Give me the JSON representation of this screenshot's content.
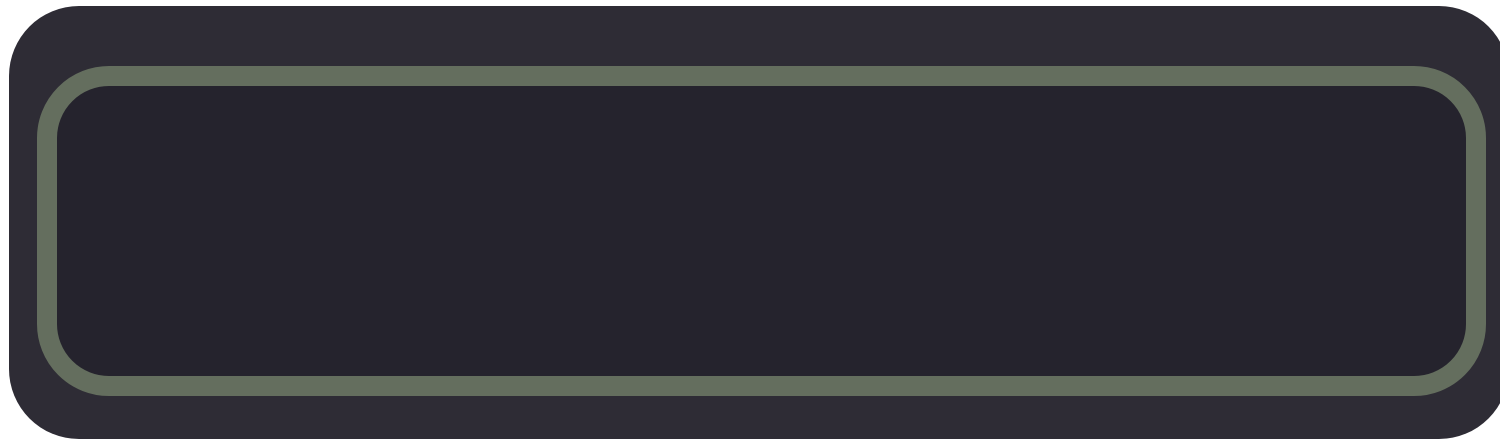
{
  "input": {
    "value": "",
    "placeholder": ""
  },
  "colors": {
    "panel_background": "#2e2c35",
    "field_background": "#25232d",
    "field_border": "#646e5e"
  }
}
